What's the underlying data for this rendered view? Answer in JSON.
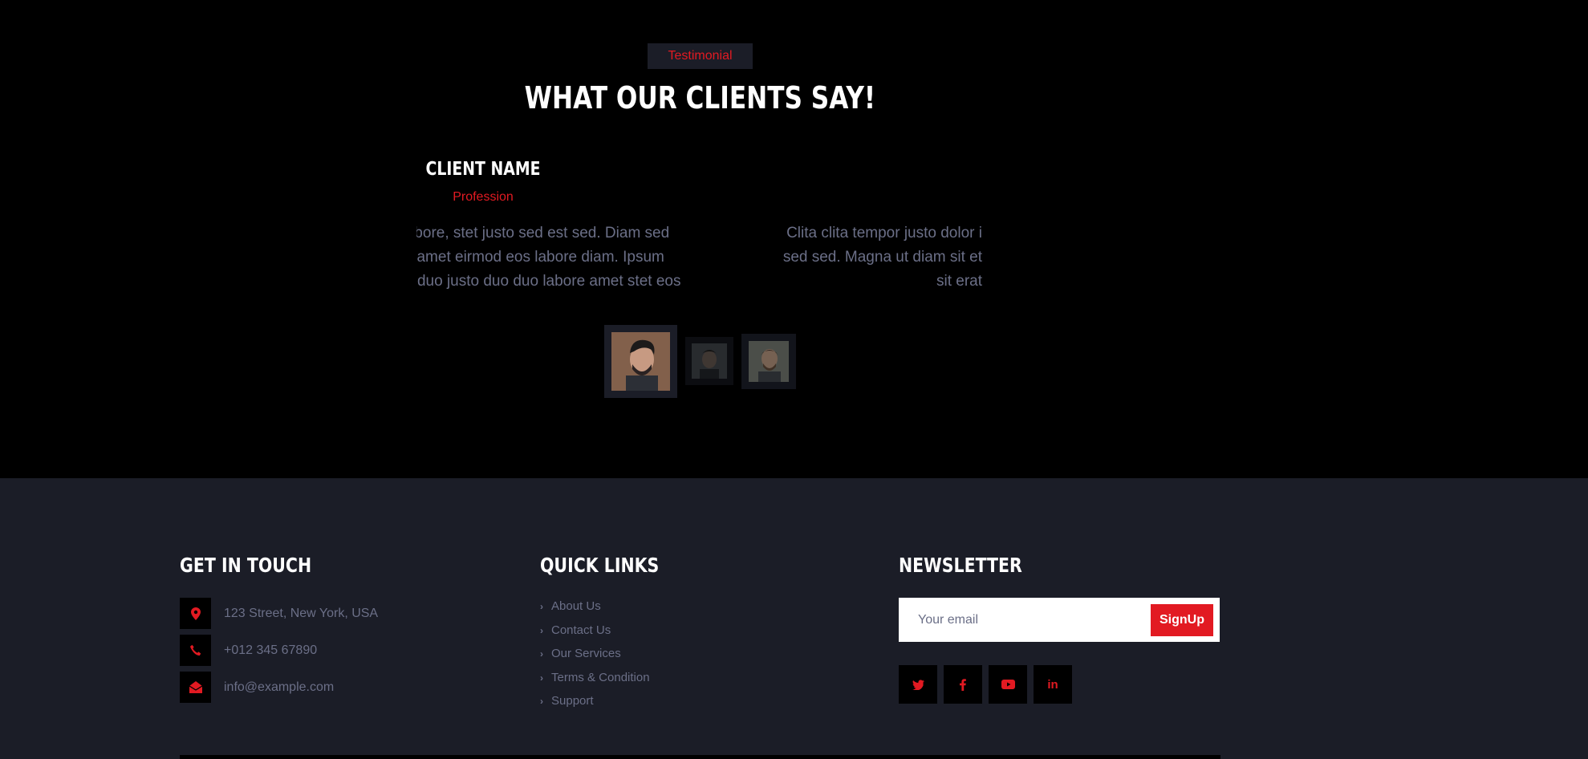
{
  "testimonial": {
    "badge": "Testimonial",
    "title": "WHAT OUR CLIENTS SAY!",
    "client_name": "CLIENT NAME",
    "profession": "Profession",
    "quote_left": "Dolor et eos labore, stet justo sed est sed. Diam sed sed dolor stet amet eirmod eos labore diam. Ipsum amet kasd amet duo justo duo duo labore amet stet eos sed clita erat magna elitr erat sit at rebum justo sea clita.",
    "quote_right_lines": [
      "Clita clita tempor justo dolor i",
      "sed sed. Magna ut diam sit et",
      "sit erat"
    ],
    "thumbnails": [
      "client-photo-1",
      "client-photo-2",
      "client-photo-3"
    ]
  },
  "footer": {
    "get_in_touch": {
      "title": "GET IN TOUCH",
      "address": "123 Street, New York, USA",
      "phone": "+012 345 67890",
      "email": "info@example.com"
    },
    "quick_links": {
      "title": "QUICK LINKS",
      "items": [
        "About Us",
        "Contact Us",
        "Our Services",
        "Terms & Condition",
        "Support"
      ]
    },
    "newsletter": {
      "title": "NEWSLETTER",
      "placeholder": "Your email",
      "button": "SignUp"
    },
    "social": [
      "twitter-icon",
      "facebook-icon",
      "youtube-icon",
      "linkedin-icon"
    ]
  },
  "colors": {
    "accent": "#e21a22",
    "footer_bg": "#1b1d27",
    "muted_text": "#6b6f87",
    "page_bg": "#000000"
  }
}
